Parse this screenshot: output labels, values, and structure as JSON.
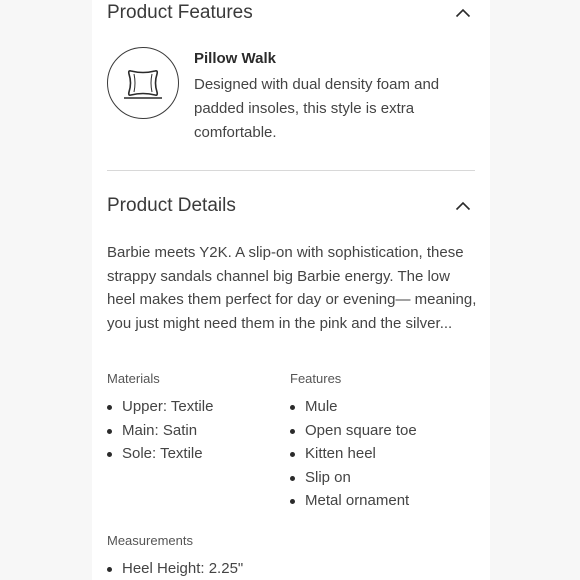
{
  "features_section": {
    "title": "Product Features",
    "feature": {
      "icon": "pillow-icon",
      "name": "Pillow Walk",
      "description": "Designed with dual density foam and padded insoles, this style is extra comfortable."
    }
  },
  "details_section": {
    "title": "Product Details",
    "description": "Barbie meets Y2K. A slip-on with sophistication, these strappy sandals channel big Barbie energy. The low heel makes them perfect for day or evening— meaning, you just might need them in the pink and the silver...",
    "materials": {
      "label": "Materials",
      "items": [
        "Upper: Textile",
        "Main: Satin",
        "Sole: Textile"
      ]
    },
    "features": {
      "label": "Features",
      "items": [
        "Mule",
        "Open square toe",
        "Kitten heel",
        "Slip on",
        "Metal ornament"
      ]
    },
    "measurements": {
      "label": "Measurements",
      "items": [
        "Heel Height: 2.25\""
      ]
    }
  }
}
